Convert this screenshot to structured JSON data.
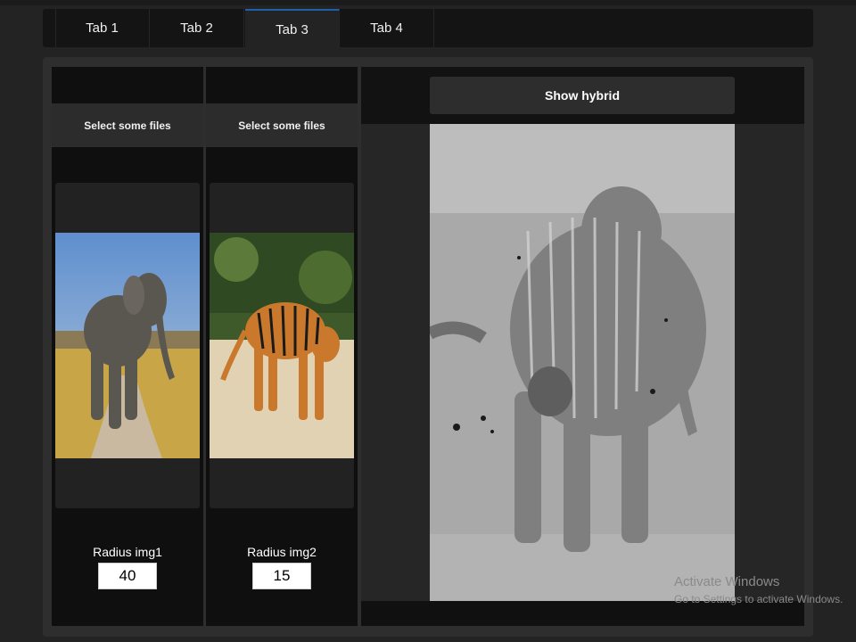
{
  "tabs": [
    {
      "label": "Tab 1",
      "active": false
    },
    {
      "label": "Tab 2",
      "active": false
    },
    {
      "label": "Tab 3",
      "active": true
    },
    {
      "label": "Tab 4",
      "active": false
    }
  ],
  "left": {
    "file_button": "Select some files",
    "image_alt": "elephant image",
    "radius_label": "Radius img1",
    "radius_value": "40"
  },
  "middle": {
    "file_button": "Select some files",
    "image_alt": "tiger image",
    "radius_label": "Radius img2",
    "radius_value": "15"
  },
  "right": {
    "button": "Show hybrid",
    "image_alt": "hybrid grayscale image"
  },
  "watermark": {
    "line1": "Activate Windows",
    "line2": "Go to Settings to activate Windows."
  },
  "colors": {
    "accent": "#1e5fae",
    "background": "#232323",
    "panel": "#2e2e2e"
  }
}
